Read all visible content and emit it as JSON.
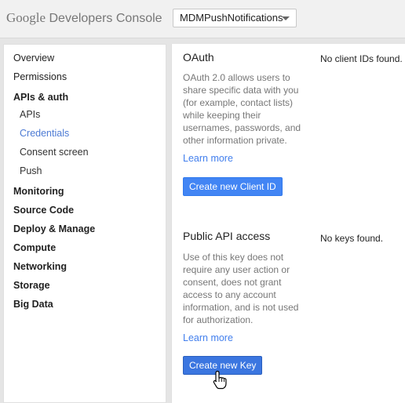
{
  "header": {
    "logo_text": "Google",
    "title": "Developers Console",
    "project_selector": "MDMPushNotifications"
  },
  "sidebar": {
    "items": [
      {
        "label": "Overview"
      },
      {
        "label": "Permissions"
      },
      {
        "label": "APIs & auth"
      },
      {
        "label": "APIs"
      },
      {
        "label": "Credentials"
      },
      {
        "label": "Consent screen"
      },
      {
        "label": "Push"
      },
      {
        "label": "Monitoring"
      },
      {
        "label": "Source Code"
      },
      {
        "label": "Deploy & Manage"
      },
      {
        "label": "Compute"
      },
      {
        "label": "Networking"
      },
      {
        "label": "Storage"
      },
      {
        "label": "Big Data"
      }
    ]
  },
  "main": {
    "oauth": {
      "heading": "OAuth",
      "description": "OAuth 2.0 allows users to share specific data with you (for example, contact lists) while keeping their usernames, passwords, and other information private.",
      "learn_more": "Learn more",
      "button": "Create new Client ID",
      "status": "No client IDs found."
    },
    "public_api": {
      "heading": "Public API access",
      "description": "Use of this key does not require any user action or consent, does not grant access to any account information, and is not used for authorization.",
      "learn_more": "Learn more",
      "button": "Create new Key",
      "status": "No keys found."
    }
  },
  "colors": {
    "accent": "#4285f4",
    "link": "#427fed",
    "active_nav": "#4d7bd4"
  }
}
